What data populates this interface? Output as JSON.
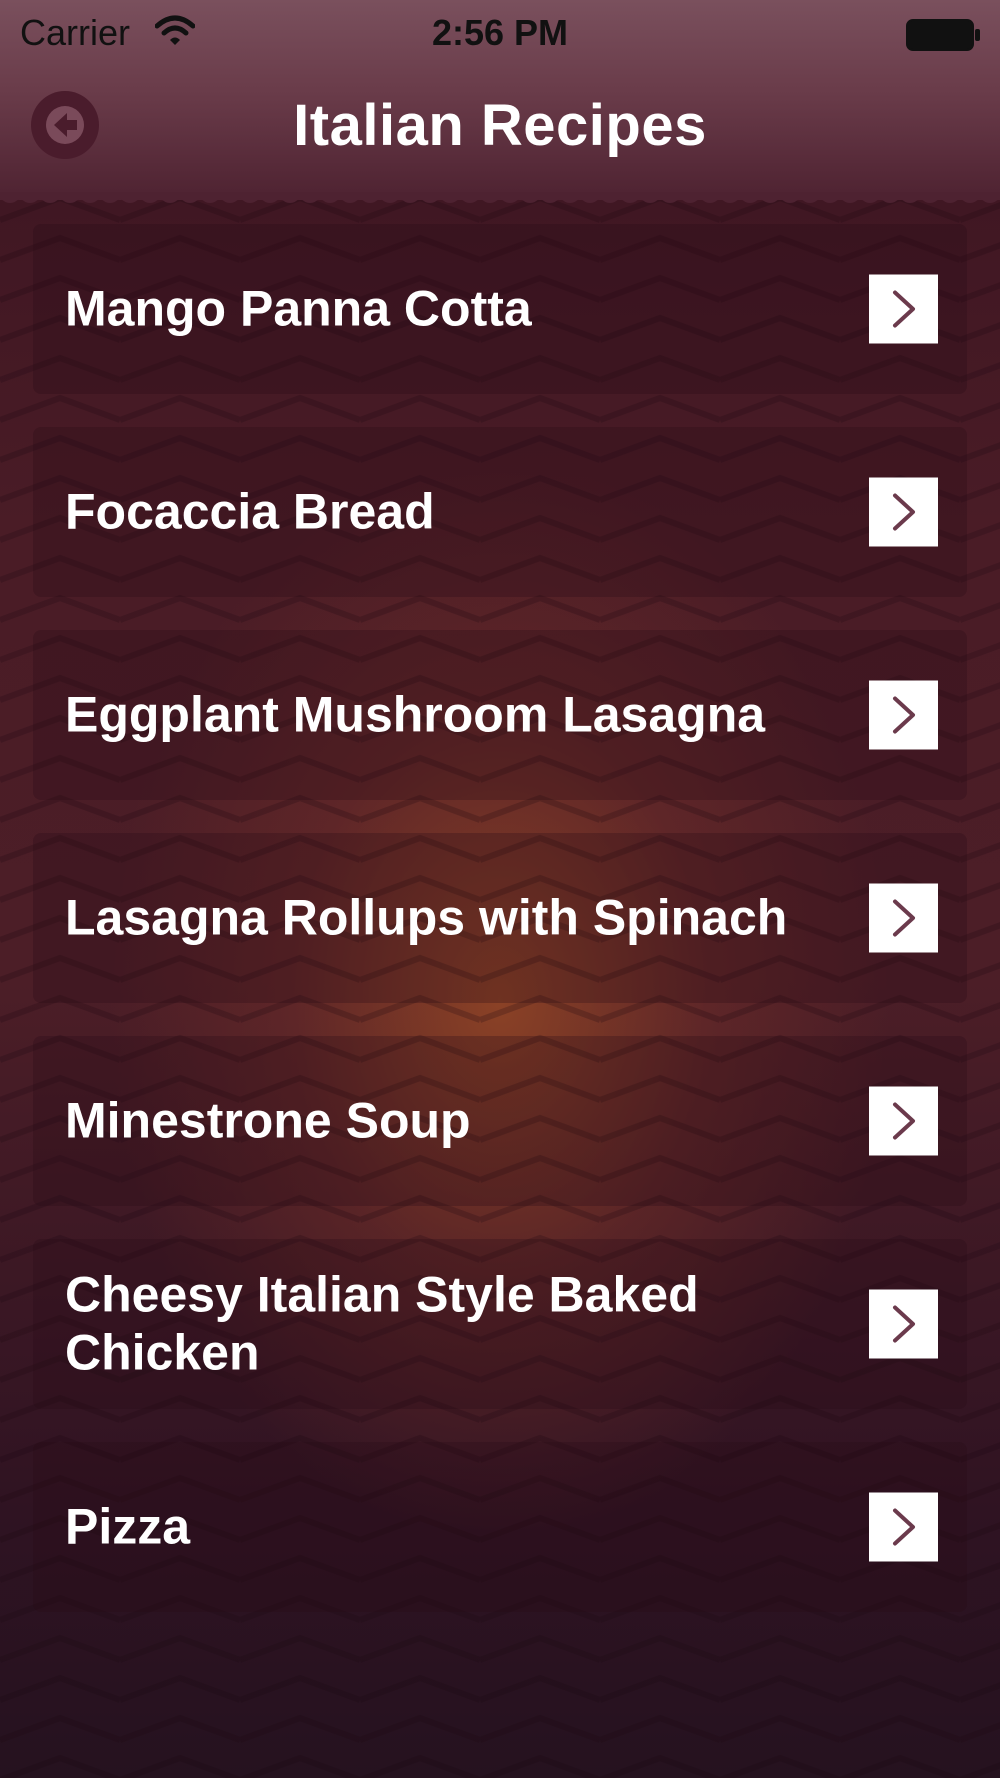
{
  "status_bar": {
    "carrier": "Carrier",
    "time": "2:56 PM"
  },
  "header": {
    "title": "Italian Recipes",
    "back_icon": "arrow-left-icon"
  },
  "recipes": [
    {
      "label": "Mango Panna Cotta",
      "icon": "chevron-right-icon"
    },
    {
      "label": "Focaccia Bread",
      "icon": "chevron-right-icon"
    },
    {
      "label": "Eggplant Mushroom Lasagna",
      "icon": "chevron-right-icon"
    },
    {
      "label": "Lasagna Rollups with Spinach",
      "icon": "chevron-right-icon"
    },
    {
      "label": "Minestrone Soup",
      "icon": "chevron-right-icon"
    },
    {
      "label": "Cheesy Italian Style Baked Chicken",
      "icon": "chevron-right-icon"
    },
    {
      "label": "Pizza",
      "icon": "chevron-right-icon"
    }
  ],
  "colors": {
    "header_top": "#7a505d",
    "header_bottom": "#4e2231",
    "background": "#3a1421",
    "accent_glow": "#96482a",
    "chevron": "#6b3a4c",
    "text": "#ffffff"
  }
}
